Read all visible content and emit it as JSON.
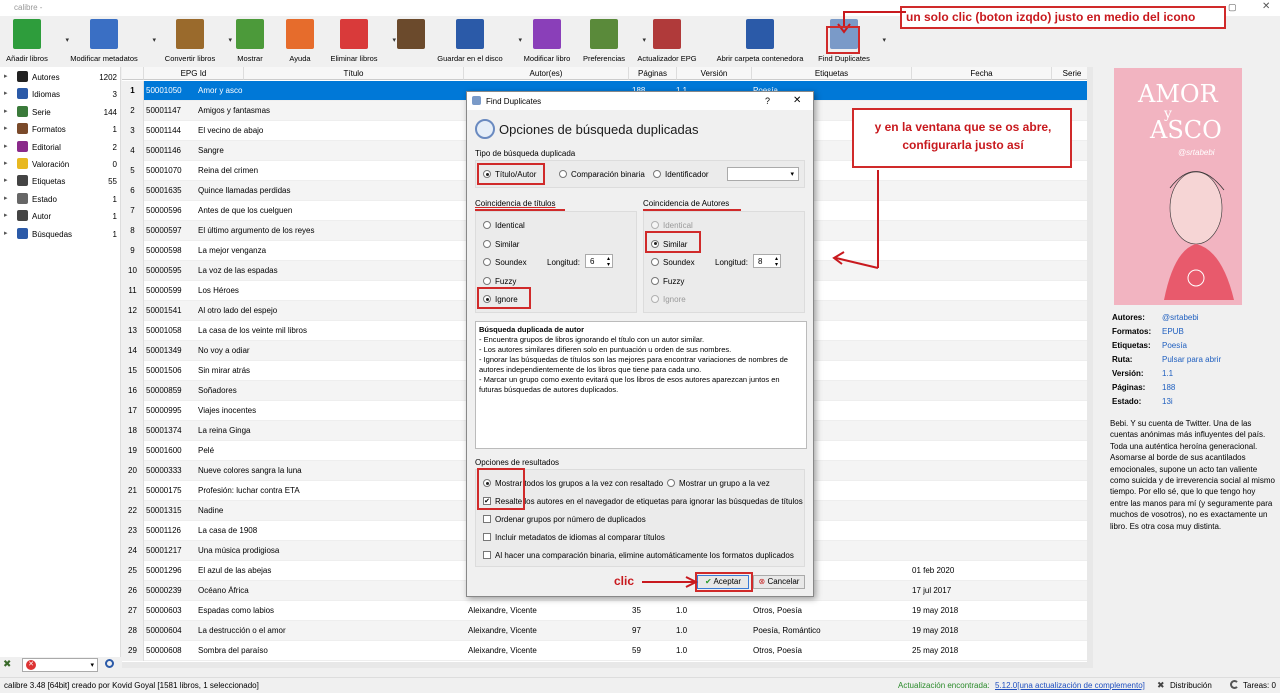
{
  "window": {
    "title": "calibre -"
  },
  "toolbar": {
    "buttons": [
      {
        "label": "Añadir libros",
        "icon": "add-books-icon",
        "color": "#2e9d3c"
      },
      {
        "label": "Modificar metadatos",
        "icon": "edit-metadata-icon",
        "color": "#3a6fc4"
      },
      {
        "label": "Convertir libros",
        "icon": "convert-books-icon",
        "color": "#9a6a2c"
      },
      {
        "label": "Mostrar",
        "icon": "view-icon",
        "color": "#4c9a3a"
      },
      {
        "label": "Ayuda",
        "icon": "help-icon",
        "color": "#e66c2c"
      },
      {
        "label": "Eliminar libros",
        "icon": "remove-books-icon",
        "color": "#d93a3a"
      },
      {
        "label": "",
        "icon": "library-icon",
        "color": "#6b4a2c"
      },
      {
        "label": "Guardar en el disco",
        "icon": "save-icon",
        "color": "#2b5aa8"
      },
      {
        "label": "Modificar libro",
        "icon": "edit-book-icon",
        "color": "#8a3fb9"
      },
      {
        "label": "Preferencias",
        "icon": "preferences-icon",
        "color": "#5a8a3a"
      },
      {
        "label": "Actualizador EPG",
        "icon": "epg-updater-icon",
        "color": "#b03a3a"
      },
      {
        "label": "Abrir carpeta contenedora",
        "icon": "folder-icon",
        "color": "#2b5aa8"
      },
      {
        "label": "Find Duplicates",
        "icon": "find-duplicates-icon",
        "color": "#7a9ac8"
      }
    ]
  },
  "annotations": {
    "top": "un solo clic (boton izqdo) justo en medio del icono",
    "middle": "y en la ventana que se os abre, configurarla justo así",
    "clic": "clic"
  },
  "sidebar": {
    "items": [
      {
        "name": "Autores",
        "count": "1202",
        "icon": "authors-icon"
      },
      {
        "name": "Idiomas",
        "count": "3",
        "icon": "languages-icon"
      },
      {
        "name": "Serie",
        "count": "144",
        "icon": "series-icon"
      },
      {
        "name": "Formatos",
        "count": "1",
        "icon": "formats-icon"
      },
      {
        "name": "Editorial",
        "count": "2",
        "icon": "publisher-icon"
      },
      {
        "name": "Valoración",
        "count": "0",
        "icon": "rating-icon"
      },
      {
        "name": "Etiquetas",
        "count": "55",
        "icon": "tags-icon"
      },
      {
        "name": "Estado",
        "count": "1",
        "icon": "status-icon"
      },
      {
        "name": "Autor",
        "count": "1",
        "icon": "author-icon"
      },
      {
        "name": "Búsquedas",
        "count": "1",
        "icon": "searches-icon"
      }
    ]
  },
  "grid": {
    "headers": [
      "EPG Id",
      "Título",
      "Autor(es)",
      "Páginas",
      "Versión",
      "Etiquetas",
      "Fecha",
      "Serie"
    ],
    "rows": [
      {
        "n": "1",
        "id": "50001050",
        "title": "Amor y asco",
        "author": "",
        "pages": "188",
        "ver": "1.1",
        "tags": "Poesía",
        "date": ""
      },
      {
        "n": "2",
        "id": "50001147",
        "title": "Amigos y fantasmas",
        "author": "",
        "pages": "",
        "ver": "",
        "tags": "",
        "date": ""
      },
      {
        "n": "3",
        "id": "50001144",
        "title": "El vecino de abajo",
        "author": "",
        "pages": "",
        "ver": "",
        "tags": "",
        "date": ""
      },
      {
        "n": "4",
        "id": "50001146",
        "title": "Sangre",
        "author": "",
        "pages": "",
        "ver": "",
        "tags": "",
        "date": ""
      },
      {
        "n": "5",
        "id": "50001070",
        "title": "Reina del crimen",
        "author": "",
        "pages": "",
        "ver": "",
        "tags": "",
        "date": ""
      },
      {
        "n": "6",
        "id": "50001635",
        "title": "Quince llamadas perdidas",
        "author": "",
        "pages": "",
        "ver": "",
        "tags": "",
        "date": ""
      },
      {
        "n": "7",
        "id": "50000596",
        "title": "Antes de que los cuelguen",
        "author": "",
        "pages": "",
        "ver": "",
        "tags": "tic",
        "date": ""
      },
      {
        "n": "8",
        "id": "50000597",
        "title": "El último argumento de los reyes",
        "author": "",
        "pages": "",
        "ver": "",
        "tags": "",
        "date": ""
      },
      {
        "n": "9",
        "id": "50000598",
        "title": "La mejor venganza",
        "author": "",
        "pages": "",
        "ver": "",
        "tags": "tic",
        "date": ""
      },
      {
        "n": "10",
        "id": "50000595",
        "title": "La voz de las espadas",
        "author": "",
        "pages": "",
        "ver": "",
        "tags": "tic",
        "date": ""
      },
      {
        "n": "11",
        "id": "50000599",
        "title": "Los Héroes",
        "author": "",
        "pages": "",
        "ver": "",
        "tags": "tic",
        "date": ""
      },
      {
        "n": "12",
        "id": "50001541",
        "title": "Al otro lado del espejo",
        "author": "",
        "pages": "",
        "ver": "",
        "tags": "",
        "date": ""
      },
      {
        "n": "13",
        "id": "50001058",
        "title": "La casa de los veinte mil libros",
        "author": "",
        "pages": "",
        "ver": "",
        "tags": "s",
        "date": ""
      },
      {
        "n": "14",
        "id": "50001349",
        "title": "No voy a odiar",
        "author": "",
        "pages": "",
        "ver": "",
        "tags": "s",
        "date": ""
      },
      {
        "n": "15",
        "id": "50001506",
        "title": "Sin mirar atrás",
        "author": "",
        "pages": "",
        "ver": "",
        "tags": "",
        "date": ""
      },
      {
        "n": "16",
        "id": "50000859",
        "title": "Soñadores",
        "author": "",
        "pages": "",
        "ver": "",
        "tags": "",
        "date": ""
      },
      {
        "n": "17",
        "id": "50000995",
        "title": "Viajes inocentes",
        "author": "",
        "pages": "",
        "ver": "",
        "tags": "",
        "date": ""
      },
      {
        "n": "18",
        "id": "50001374",
        "title": "La reina Ginga",
        "author": "",
        "pages": "",
        "ver": "",
        "tags": "",
        "date": ""
      },
      {
        "n": "19",
        "id": "50001600",
        "title": "Pelé",
        "author": "",
        "pages": "",
        "ver": "",
        "tags": ", E",
        "date": ""
      },
      {
        "n": "20",
        "id": "50000333",
        "title": "Nueve colores sangra la luna",
        "author": "",
        "pages": "",
        "ver": "",
        "tags": "",
        "date": ""
      },
      {
        "n": "21",
        "id": "50000175",
        "title": "Profesión: luchar contra ETA",
        "author": "",
        "pages": "",
        "ver": "",
        "tags": "Cr",
        "date": ""
      },
      {
        "n": "22",
        "id": "50001315",
        "title": "Nadine",
        "author": "",
        "pages": "",
        "ver": "",
        "tags": "",
        "date": ""
      },
      {
        "n": "23",
        "id": "50001126",
        "title": "La casa de 1908",
        "author": "",
        "pages": "",
        "ver": "",
        "tags": "",
        "date": ""
      },
      {
        "n": "24",
        "id": "50001217",
        "title": "Una música prodigiosa",
        "author": "",
        "pages": "",
        "ver": "",
        "tags": "",
        "date": ""
      },
      {
        "n": "25",
        "id": "50001296",
        "title": "El azul de las abejas",
        "author": "",
        "pages": "",
        "ver": "",
        "tags": "",
        "date": "01 feb 2020"
      },
      {
        "n": "26",
        "id": "50000239",
        "title": "Océano África",
        "author": "",
        "pages": "",
        "ver": "",
        "tags": "",
        "date": "17 jul 2017"
      },
      {
        "n": "27",
        "id": "50000603",
        "title": "Espadas como labios",
        "author": "Aleixandre, Vicente",
        "pages": "35",
        "ver": "1.0",
        "tags": "Otros, Poesía",
        "date": "19 may 2018"
      },
      {
        "n": "28",
        "id": "50000604",
        "title": "La destrucción o el amor",
        "author": "Aleixandre, Vicente",
        "pages": "97",
        "ver": "1.0",
        "tags": "Poesía, Romántico",
        "date": "19 may 2018"
      },
      {
        "n": "29",
        "id": "50000608",
        "title": "Sombra del paraíso",
        "author": "Aleixandre, Vicente",
        "pages": "59",
        "ver": "1.0",
        "tags": "Otros, Poesía",
        "date": "25 may 2018"
      }
    ]
  },
  "cover": {
    "line1": "AMOR",
    "line2": "y",
    "line3": "ASCO",
    "handle": "@srtabebi"
  },
  "details": {
    "autores_label": "Autores:",
    "autores": "@srtabebi",
    "formatos_label": "Formatos:",
    "formatos": "EPUB",
    "etiquetas_label": "Etiquetas:",
    "etiquetas": "Poesía",
    "ruta_label": "Ruta:",
    "ruta": "Pulsar para abrir",
    "version_label": "Versión:",
    "version": "1.1",
    "paginas_label": "Páginas:",
    "paginas": "188",
    "estado_label": "Estado:",
    "estado": "13i",
    "desc": "Bebi. Y su cuenta de Twitter. Una de las cuentas anónimas más influyentes del país. Toda una auténtica heroína generacional. Asomarse al borde de sus acantilados emocionales, supone un acto tan valiente como suicida y de irreverencia social al mismo tiempo. Por ello sé, que lo que tengo hoy entre las manos para mí (y seguramente para muchos de vosotros), no es exactamente un libro. Es otra cosa muy distinta."
  },
  "dialog": {
    "title": "Find Duplicates",
    "help": "?",
    "heading": "Opciones de búsqueda duplicadas",
    "search_type_label": "Tipo de búsqueda duplicada",
    "search_types": [
      "Título/Autor",
      "Comparación binaria",
      "Identificador"
    ],
    "title_match_label": "Coincidencia de títulos",
    "title_opts": [
      "Identical",
      "Similar",
      "Soundex",
      "Fuzzy",
      "Ignore"
    ],
    "author_match_label": "Coincidencia de Autores",
    "author_opts": [
      "Identical",
      "Similar",
      "Soundex",
      "Fuzzy",
      "Ignore"
    ],
    "length_label": "Longitud:",
    "title_length": "6",
    "author_length": "8",
    "desc_title": "Búsqueda duplicada de autor",
    "desc_lines": [
      "- Encuentra grupos de libros ignorando el título con un autor similar.",
      "- Los autores similares difieren solo en puntuación u orden de sus nombres.",
      "- Ignorar las búsquedas de títulos son las mejores para encontrar variaciones de nombres de autores independientemente de los libros que tiene para cada uno.",
      "- Marcar un grupo como exento evitará que los libros de esos autores aparezcan juntos en futuras búsquedas de autores duplicados."
    ],
    "results_label": "Opciones de resultados",
    "result_radio1": "Mostrar todos los grupos a la vez con resaltado",
    "result_radio2": "Mostrar un grupo a la vez",
    "check1": "Resalte los autores en el navegador de etiquetas para ignorar las búsquedas de títulos",
    "check2": "Ordenar grupos por número de duplicados",
    "check3": "Incluir metadatos de idiomas al comparar títulos",
    "check4": "Al hacer una comparación binaria, elimine automáticamente los formatos duplicados",
    "ok": "Aceptar",
    "cancel": "Cancelar"
  },
  "status": {
    "left": "calibre 3.48 [64bit] creado por Kovid Goyal   [1581 libros, 1 seleccionado]",
    "update_label": "Actualización encontrada:",
    "update_link": "5.12.0[una actualización de complemento]",
    "distribution": "Distribución",
    "tasks": "Tareas: 0"
  }
}
